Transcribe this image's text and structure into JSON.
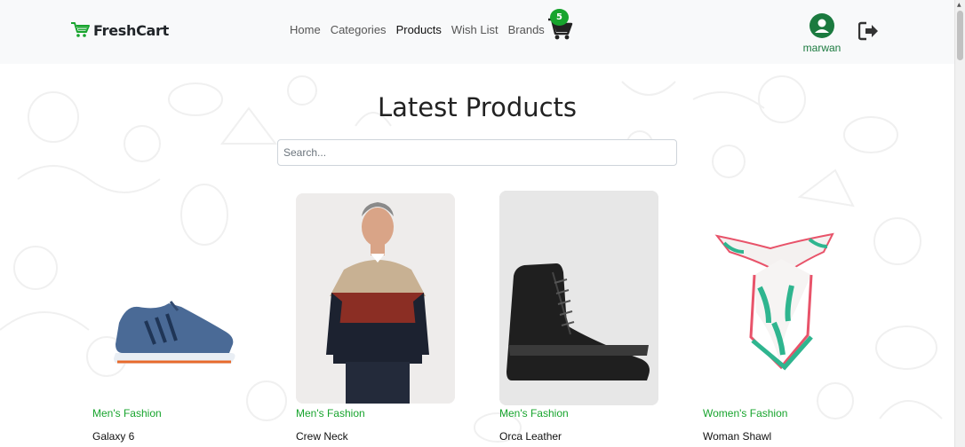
{
  "brand": {
    "name": "FreshCart",
    "accent": "#17a42d"
  },
  "nav": {
    "links": [
      {
        "label": "Home",
        "active": false
      },
      {
        "label": "Categories",
        "active": false
      },
      {
        "label": "Products",
        "active": true
      },
      {
        "label": "Wish List",
        "active": false
      },
      {
        "label": "Brands",
        "active": false
      }
    ],
    "cart_count": "5",
    "user_name": "marwan"
  },
  "main": {
    "heading": "Latest Products",
    "search": {
      "placeholder": "Search...",
      "value": ""
    },
    "products": [
      {
        "category": "Men's Fashion",
        "title": "Galaxy 6",
        "icon": "sneaker-image"
      },
      {
        "category": "Men's Fashion",
        "title": "Crew Neck",
        "icon": "sweater-model-image"
      },
      {
        "category": "Men's Fashion",
        "title": "Orca Leather",
        "icon": "boot-image"
      },
      {
        "category": "Women's Fashion",
        "title": "Woman Shawl",
        "icon": "scarf-image"
      }
    ]
  }
}
